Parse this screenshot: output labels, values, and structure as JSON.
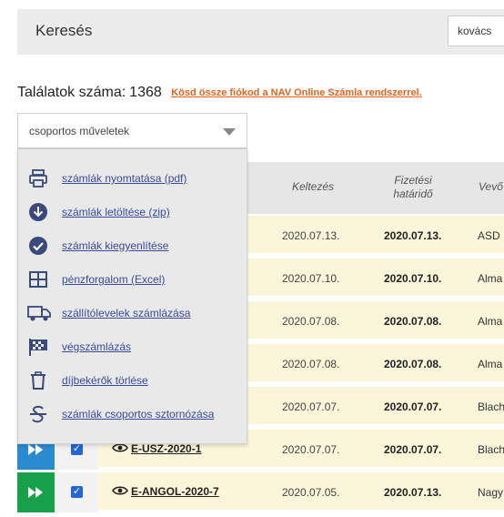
{
  "header": {
    "title": "Keresés",
    "search_value": "kovács"
  },
  "results": {
    "label": "Találatok száma:",
    "count": "1368",
    "link": "Kösd össze fiókod a NAV Online Számla rendszerrel."
  },
  "bulk_select": {
    "label": "csoportos műveletek"
  },
  "menu": {
    "items": [
      {
        "label": "számlák nyomtatása (pdf)",
        "icon": "printer-icon"
      },
      {
        "label": "számlák letöltése (zip)",
        "icon": "download-icon"
      },
      {
        "label": "számlák kiegyenlítése",
        "icon": "check-circle-icon"
      },
      {
        "label": "pénzforgalom (Excel)",
        "icon": "table-icon"
      },
      {
        "label": "szállítólevelek számlázása",
        "icon": "truck-icon"
      },
      {
        "label": "végszámlázás",
        "icon": "checkered-flag-icon"
      },
      {
        "label": "díjbekérők törlése",
        "icon": "trash-icon"
      },
      {
        "label": "számlák csoportos sztornózása",
        "icon": "strikethrough-icon"
      }
    ]
  },
  "table": {
    "headers": {
      "kelt": "Keltezés",
      "hatarido_1": "Fizetési",
      "hatarido_2": "határidő",
      "vevo": "Vevő"
    },
    "rows": [
      {
        "number": "",
        "kelt": "2020.07.13.",
        "hatarido": "2020.07.13.",
        "vevo": "ASD"
      },
      {
        "number": "",
        "kelt": "2020.07.10.",
        "hatarido": "2020.07.10.",
        "vevo": "Alma"
      },
      {
        "number": "",
        "kelt": "2020.07.08.",
        "hatarido": "2020.07.08.",
        "vevo": "Alma"
      },
      {
        "number": "",
        "kelt": "2020.07.08.",
        "hatarido": "2020.07.08.",
        "vevo": "Alma"
      },
      {
        "number": "",
        "kelt": "2020.07.07.",
        "hatarido": "2020.07.07.",
        "vevo": "Blach"
      },
      {
        "number": "E-ÜSZ-2020-1",
        "kelt": "2020.07.07.",
        "hatarido": "2020.07.07.",
        "vevo": "Blach"
      },
      {
        "number": "E-ANGOL-2020-7",
        "kelt": "2020.07.05.",
        "hatarido": "2020.07.13.",
        "vevo": "Nagy"
      }
    ]
  },
  "colors": {
    "action_blue": "#2b8bd0",
    "action_green": "#16a14a",
    "link_orange": "#e8621a",
    "row_yellow": "#fbf6da"
  }
}
